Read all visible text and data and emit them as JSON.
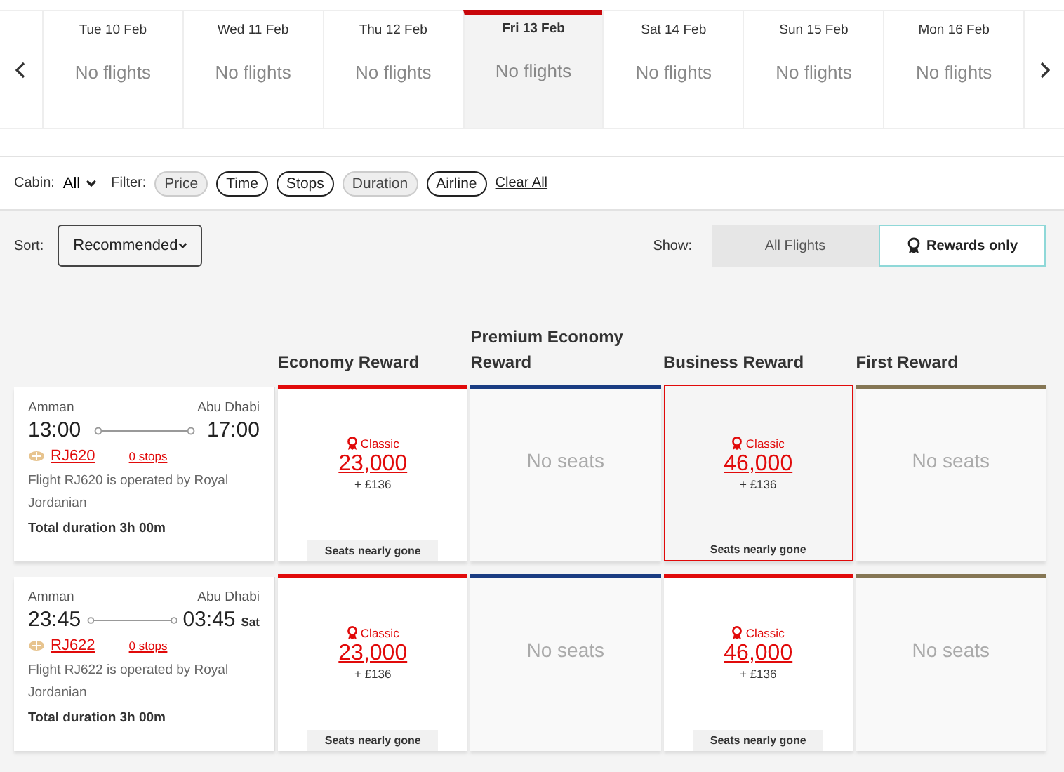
{
  "dates": [
    {
      "day": "Tue 10 Feb",
      "status": "No flights",
      "selected": false
    },
    {
      "day": "Wed 11 Feb",
      "status": "No flights",
      "selected": false
    },
    {
      "day": "Thu 12 Feb",
      "status": "No flights",
      "selected": false
    },
    {
      "day": "Fri 13 Feb",
      "status": "No flights",
      "selected": true
    },
    {
      "day": "Sat 14 Feb",
      "status": "No flights",
      "selected": false
    },
    {
      "day": "Sun 15 Feb",
      "status": "No flights",
      "selected": false
    },
    {
      "day": "Mon 16 Feb",
      "status": "No flights",
      "selected": false
    }
  ],
  "filters": {
    "cabin_label": "Cabin:",
    "cabin_value": "All",
    "filter_label": "Filter:",
    "chips": [
      {
        "label": "Price",
        "disabled": true
      },
      {
        "label": "Time",
        "disabled": false
      },
      {
        "label": "Stops",
        "disabled": false
      },
      {
        "label": "Duration",
        "disabled": true
      },
      {
        "label": "Airline",
        "disabled": false
      }
    ],
    "clear": "Clear All"
  },
  "sort": {
    "label": "Sort:",
    "value": "Recommended"
  },
  "show": {
    "label": "Show:",
    "options": [
      {
        "label": "All Flights",
        "selected": false
      },
      {
        "label": "Rewards only",
        "selected": true
      }
    ]
  },
  "cabins": [
    {
      "name": "Economy Reward",
      "color": "#e10a0a"
    },
    {
      "name": "Premium Economy Reward",
      "color": "#1a3c82"
    },
    {
      "name": "Business Reward",
      "color": "#e10a0a"
    },
    {
      "name": "First Reward",
      "color": "#857654"
    }
  ],
  "flights": [
    {
      "origin": "Amman",
      "destination": "Abu Dhabi",
      "depart": "13:00",
      "arrive": "17:00",
      "flight_number": "RJ620",
      "stops": "0 stops",
      "operator": "Flight RJ620 is operated by Royal Jordanian",
      "duration": "Total duration 3h 00m",
      "fares": [
        {
          "kind": "fare",
          "tag": "Classic",
          "points": "23,000",
          "fee": "+ £136",
          "note": "Seats nearly gone",
          "selected": false
        },
        {
          "kind": "none",
          "text": "No seats",
          "selected": false
        },
        {
          "kind": "fare",
          "tag": "Classic",
          "points": "46,000",
          "fee": "+ £136",
          "note": "Seats nearly gone",
          "selected": true
        },
        {
          "kind": "none",
          "text": "No seats",
          "selected": false
        }
      ]
    },
    {
      "origin": "Amman",
      "destination": "Abu Dhabi",
      "depart": "23:45",
      "arrive": "03:45",
      "arrive_day": "Sat",
      "flight_number": "RJ622",
      "stops": "0 stops",
      "operator": "Flight RJ622 is operated by Royal Jordanian",
      "duration": "Total duration 3h 00m",
      "fares": [
        {
          "kind": "fare",
          "tag": "Classic",
          "points": "23,000",
          "fee": "+ £136",
          "note": "Seats nearly gone",
          "selected": false
        },
        {
          "kind": "none",
          "text": "No seats",
          "selected": false
        },
        {
          "kind": "fare",
          "tag": "Classic",
          "points": "46,000",
          "fee": "+ £136",
          "note": "Seats nearly gone",
          "selected": false
        },
        {
          "kind": "none",
          "text": "No seats",
          "selected": false
        }
      ]
    }
  ]
}
